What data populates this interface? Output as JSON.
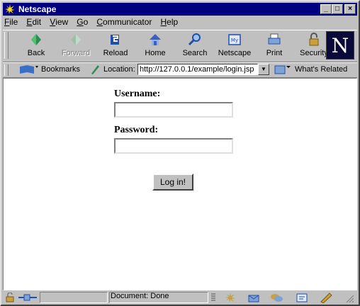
{
  "window": {
    "title": "Netscape"
  },
  "menu": [
    {
      "label": "File",
      "key": "F",
      "rest": "ile"
    },
    {
      "label": "Edit",
      "key": "E",
      "rest": "dit"
    },
    {
      "label": "View",
      "key": "V",
      "rest": "iew"
    },
    {
      "label": "Go",
      "key": "G",
      "rest": "o"
    },
    {
      "label": "Communicator",
      "key": "C",
      "rest": "ommunicator"
    },
    {
      "label": "Help",
      "key": "H",
      "rest": "elp"
    }
  ],
  "toolbar": {
    "back": "Back",
    "forward": "Forward",
    "reload": "Reload",
    "home": "Home",
    "search": "Search",
    "netscape": "Netscape",
    "print": "Print",
    "security": "Security",
    "logo_letter": "N"
  },
  "location_bar": {
    "bookmarks": "Bookmarks",
    "location_label": "Location:",
    "url": "http://127.0.0.1/example/login.jsp",
    "whats_related": "What's Related"
  },
  "form": {
    "username_label": "Username:",
    "password_label": "Password:",
    "username_value": "",
    "password_value": "",
    "submit_label": "Log in!"
  },
  "status": {
    "text": "Document: Done"
  }
}
